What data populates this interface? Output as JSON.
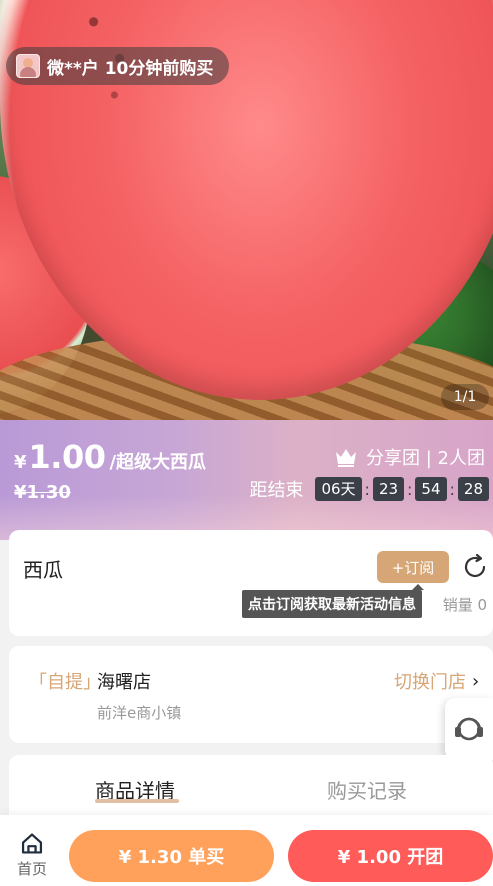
{
  "hero": {
    "buyer_notice": "微**户 10分钟前购买",
    "pager": "1/1"
  },
  "price": {
    "currency": "¥",
    "current": "1.00",
    "product_short": "/超级大西瓜",
    "original": "¥1.30",
    "group_type": "分享团 | 2人团",
    "countdown_label": "距结束",
    "countdown": {
      "days": "06天",
      "hours": "23",
      "minutes": "54",
      "seconds": "28",
      "sep": ":"
    }
  },
  "product_card": {
    "title": "西瓜",
    "subscribe_label": "+订阅",
    "tooltip": "点击订阅获取最新活动信息",
    "sales": "销量 0"
  },
  "store_card": {
    "pickup_tag": "「自提」",
    "store_name": "海曙店",
    "store_address": "前洋e商小镇",
    "switch_label": "切换门店",
    "chevron": "›"
  },
  "tabs": {
    "detail": "商品详情",
    "records": "购买记录"
  },
  "bottom_bar": {
    "home_label": "首页",
    "buy_single": "¥ 1.30 单买",
    "buy_group": "¥ 1.00 开团"
  },
  "colors": {
    "accent_gold": "#d6a677",
    "single_buy": "#ffa05b",
    "group_buy": "#ff5b59",
    "countdown_bg": "#3b3f48"
  },
  "icons": [
    "avatar",
    "crown-icon",
    "refresh-icon",
    "customer-service-icon",
    "home-icon",
    "chevron-right-icon"
  ]
}
